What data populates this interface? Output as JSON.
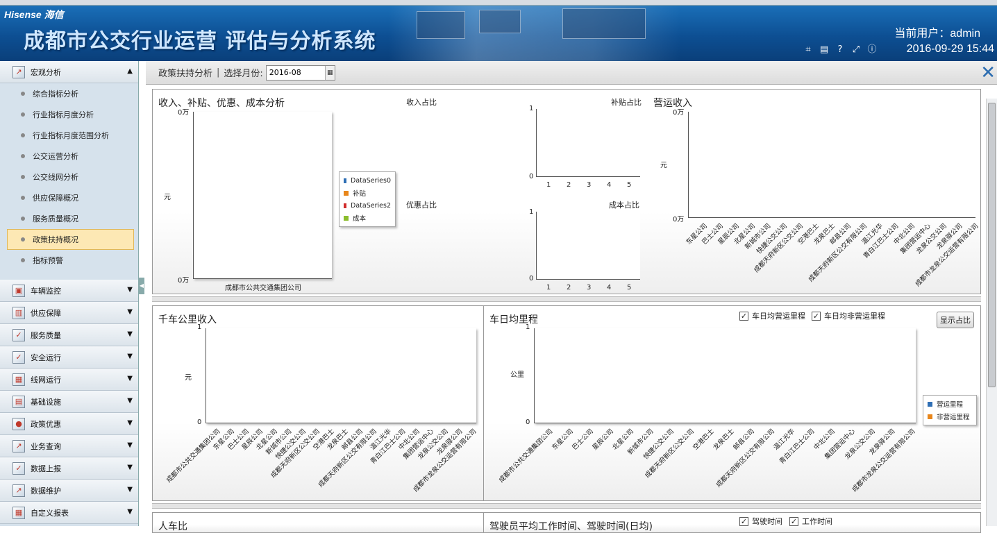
{
  "header": {
    "brand": "Hisense 海信",
    "system_title": "成都市公交行业运营 评估与分析系统",
    "user_text": "当前用户：admin",
    "datetime": "2016-09-29 15:44",
    "icons": [
      "crop-icon",
      "keyboard-icon",
      "help-icon",
      "fullscreen-icon",
      "info-icon"
    ]
  },
  "sidebar": {
    "groups": [
      {
        "label": "宏观分析",
        "icon": "chart-icon",
        "expanded": true
      },
      {
        "label": "车辆监控",
        "icon": "monitor-icon"
      },
      {
        "label": "供应保障",
        "icon": "supply-icon"
      },
      {
        "label": "服务质量",
        "icon": "quality-icon"
      },
      {
        "label": "安全运行",
        "icon": "safety-icon"
      },
      {
        "label": "线网运行",
        "icon": "network-icon"
      },
      {
        "label": "基础设施",
        "icon": "infrastructure-icon"
      },
      {
        "label": "政策优惠",
        "icon": "policy-icon"
      },
      {
        "label": "业务查询",
        "icon": "query-icon"
      },
      {
        "label": "数据上报",
        "icon": "report-icon"
      },
      {
        "label": "数据维护",
        "icon": "maintain-icon"
      },
      {
        "label": "自定义报表",
        "icon": "table-icon"
      }
    ],
    "subitems": [
      "综合指标分析",
      "行业指标月度分析",
      "行业指标月度范围分析",
      "公交运营分析",
      "公交线网分析",
      "供应保障概况",
      "服务质量概况",
      "政策扶持概况",
      "指标预警"
    ],
    "active_subitem": "政策扶持概况"
  },
  "toolbar": {
    "breadcrumb": "政策扶持分析",
    "separator": "|",
    "month_label": "选择月份:",
    "month_value": "2016-08"
  },
  "panel1": {
    "title": "收入、补贴、优惠、成本分析",
    "ytop": "0万",
    "ybottom": "0万",
    "yunit": "元",
    "xcat": "成都市公共交通集团公司",
    "legend": [
      {
        "label": "DataSeries0",
        "color": "#2f6fb5"
      },
      {
        "label": "补贴",
        "color": "#e8861b"
      },
      {
        "label": "DataSeries2",
        "color": "#d12c2c"
      },
      {
        "label": "成本",
        "color": "#8bbd2c"
      }
    ],
    "income_share": "收入占比",
    "discount_share": "优惠占比",
    "subsidy_share": "补贴占比",
    "cost_share": "成本占比",
    "mini_y": [
      "1",
      "0"
    ],
    "mini_x": [
      "1",
      "2",
      "3",
      "4",
      "5"
    ]
  },
  "panel2": {
    "title": "营运收入",
    "ytop": "0万",
    "ybottom": "0万",
    "yunit": "元",
    "companies": [
      "东星公司",
      "巴士公司",
      "星辰公司",
      "北星公司",
      "新城市公司",
      "快捷公交公司",
      "成都天府新区公交公司",
      "空港巴士",
      "龙泉巴士",
      "邮县公司",
      "成都天府新区公交有限公司",
      "温江光华",
      "青白江巴士公司",
      "中北公司",
      "集团营运中心",
      "龙泉公交公司",
      "龙泉驿公司",
      "成都市龙泉公交运营有限公司"
    ]
  },
  "panel3": {
    "title": "千车公里收入",
    "ytop": "1",
    "ybottom": "0",
    "yunit": "元",
    "companies": [
      "成都市公共交通集团公司",
      "东星公司",
      "巴士公司",
      "星辰公司",
      "北星公司",
      "新城市公司",
      "快捷公交公司",
      "成都天府新区公交公司",
      "空港巴士",
      "龙泉巴士",
      "邮县公司",
      "成都天府新区公交有限公司",
      "温江光华",
      "青白江巴士公司",
      "中北公司",
      "集团营运中心",
      "龙泉公交公司",
      "龙泉驿公司",
      "成都市龙泉公交运营有限公司"
    ]
  },
  "panel4": {
    "title": "车日均里程",
    "check1": "车日均营运里程",
    "check2": "车日均非营运里程",
    "show_button": "显示占比",
    "ytop": "1",
    "ybottom": "0",
    "yunit": "公里",
    "legend": [
      {
        "label": "营运里程",
        "color": "#2f6fb5"
      },
      {
        "label": "非营运里程",
        "color": "#e8861b"
      }
    ],
    "companies": [
      "成都市公共交通集团公司",
      "东星公司",
      "巴士公司",
      "星辰公司",
      "北星公司",
      "新城市公司",
      "快捷公交公司",
      "成都天府新区公交公司",
      "空港巴士",
      "龙泉巴士",
      "邮县公司",
      "成都天府新区公交有限公司",
      "温江光华",
      "青白江巴士公司",
      "中北公司",
      "集团营运中心",
      "龙泉公交公司",
      "龙泉驿公司",
      "成都市龙泉公交运营有限公司"
    ]
  },
  "panel5": {
    "title": "人车比",
    "title2": "驾驶员平均工作时间、驾驶时间(日均)",
    "check1": "驾驶时间",
    "check2": "工作时间"
  }
}
